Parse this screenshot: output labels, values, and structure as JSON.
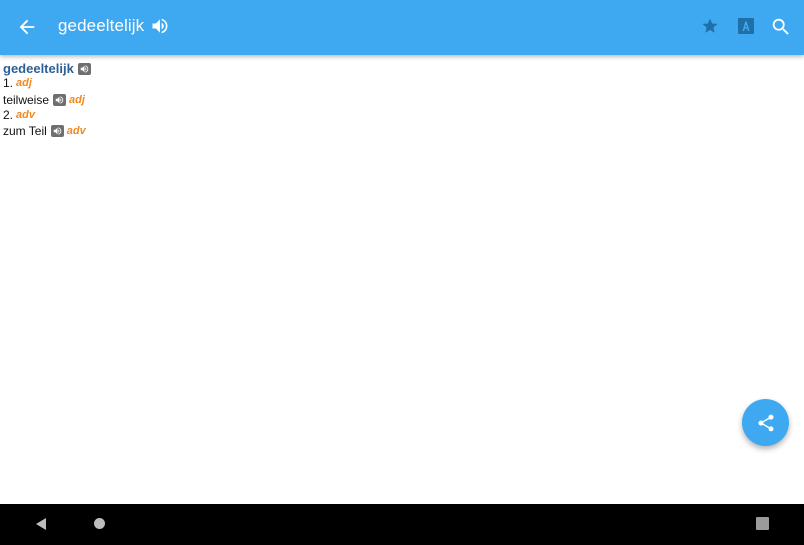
{
  "appbar": {
    "title": "gedeeltelijk",
    "icons": [
      "back-arrow-icon",
      "speaker-icon",
      "star-icon",
      "font-icon",
      "search-icon"
    ],
    "color": "#3ea9f0"
  },
  "entry": {
    "headword": "gedeeltelijk",
    "senses": [
      {
        "number": "1.",
        "pos": "adj",
        "translation": "teilweise",
        "translation_pos": "adj"
      },
      {
        "number": "2.",
        "pos": "adv",
        "translation": "zum Teil",
        "translation_pos": "adv"
      }
    ]
  },
  "fab": {
    "icon": "share-icon"
  },
  "navbar": {
    "icons": [
      "nav-back-icon",
      "nav-home-icon",
      "nav-recents-icon"
    ]
  },
  "colors": {
    "headword": "#2e5f96",
    "pos": "#f08a24",
    "accent": "#3ea9f0"
  }
}
